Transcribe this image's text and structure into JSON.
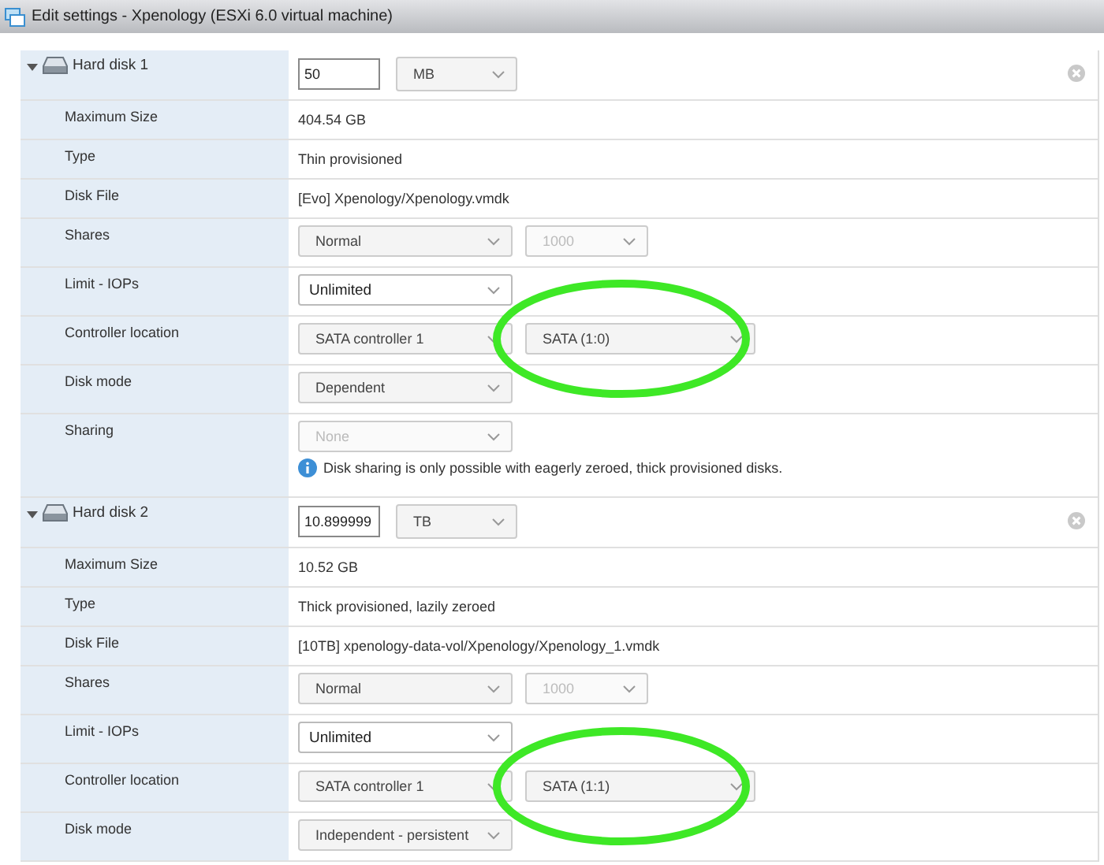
{
  "window": {
    "title": "Edit settings - Xpenology (ESXi 6.0 virtual machine)"
  },
  "disks": [
    {
      "name": "Hard disk 1",
      "expanded": true,
      "size": {
        "value": "50",
        "unit": "MB"
      },
      "rows": [
        {
          "kind": "text",
          "label": "Maximum Size",
          "value": "404.54 GB"
        },
        {
          "kind": "text",
          "label": "Type",
          "value": "Thin provisioned"
        },
        {
          "kind": "text",
          "label": "Disk File",
          "value": "[Evo] Xpenology/Xpenology.vmdk"
        },
        {
          "kind": "selects",
          "label": "Shares",
          "selects": [
            {
              "kind": "select",
              "value": "Normal",
              "disabled": false,
              "highlighted": false
            },
            {
              "kind": "select",
              "value": "1000",
              "disabled": true,
              "highlighted": false
            }
          ]
        },
        {
          "kind": "selects",
          "label": "Limit - IOPs",
          "selects": [
            {
              "kind": "combo",
              "value": "Unlimited",
              "disabled": false,
              "highlighted": false
            }
          ]
        },
        {
          "kind": "selects",
          "label": "Controller location",
          "selects": [
            {
              "kind": "select",
              "value": "SATA controller 1",
              "disabled": false,
              "highlighted": false
            },
            {
              "kind": "select",
              "value": "SATA (1:0)",
              "disabled": false,
              "highlighted": true
            }
          ]
        },
        {
          "kind": "selects",
          "label": "Disk mode",
          "selects": [
            {
              "kind": "select",
              "value": "Dependent",
              "disabled": false,
              "highlighted": false
            }
          ]
        },
        {
          "kind": "selects",
          "label": "Sharing",
          "selects": [
            {
              "kind": "select",
              "value": "None",
              "disabled": true,
              "highlighted": false
            }
          ],
          "note": "Disk sharing is only possible with eagerly zeroed, thick provisioned disks."
        }
      ]
    },
    {
      "name": "Hard disk 2",
      "expanded": true,
      "size": {
        "value": "10.899999",
        "unit": "TB"
      },
      "rows": [
        {
          "kind": "text",
          "label": "Maximum Size",
          "value": "10.52 GB"
        },
        {
          "kind": "text",
          "label": "Type",
          "value": "Thick provisioned, lazily zeroed"
        },
        {
          "kind": "text",
          "label": "Disk File",
          "value": "[10TB] xpenology-data-vol/Xpenology/Xpenology_1.vmdk"
        },
        {
          "kind": "selects",
          "label": "Shares",
          "selects": [
            {
              "kind": "select",
              "value": "Normal",
              "disabled": false,
              "highlighted": false
            },
            {
              "kind": "select",
              "value": "1000",
              "disabled": true,
              "highlighted": false
            }
          ]
        },
        {
          "kind": "selects",
          "label": "Limit - IOPs",
          "selects": [
            {
              "kind": "combo",
              "value": "Unlimited",
              "disabled": false,
              "highlighted": false
            }
          ]
        },
        {
          "kind": "selects",
          "label": "Controller location",
          "selects": [
            {
              "kind": "select",
              "value": "SATA controller 1",
              "disabled": false,
              "highlighted": false
            },
            {
              "kind": "select",
              "value": "SATA (1:1)",
              "disabled": false,
              "highlighted": true
            }
          ]
        },
        {
          "kind": "selects",
          "label": "Disk mode",
          "selects": [
            {
              "kind": "select",
              "value": "Independent - persistent",
              "disabled": false,
              "highlighted": false
            }
          ]
        }
      ]
    }
  ]
}
